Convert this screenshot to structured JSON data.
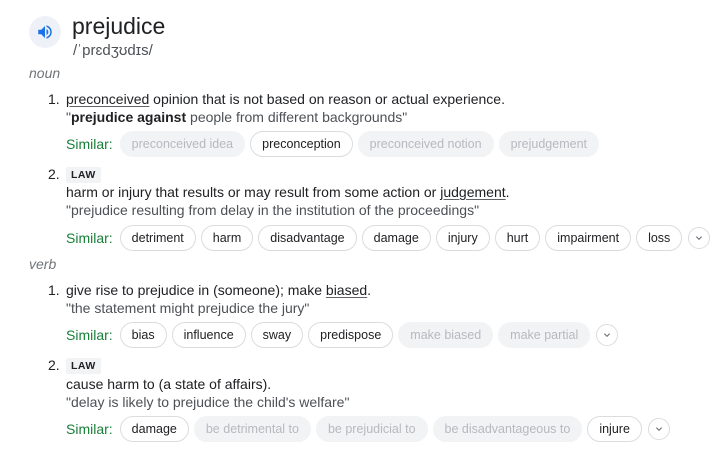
{
  "entry": {
    "word": "prejudice",
    "phonetic": "/ˈprɛdʒʊdɪs/",
    "audio_icon": "speaker-icon"
  },
  "noun": {
    "label": "noun",
    "senses": [
      {
        "number": "1.",
        "def_link": "preconceived",
        "def_rest": " opinion that is not based on reason or actual experience.",
        "example_open": "\"",
        "example_bold": "prejudice against",
        "example_rest": " people from different backgrounds\"",
        "similar_label": "Similar:",
        "similar": [
          {
            "text": "preconceived idea",
            "muted": true
          },
          {
            "text": "preconception",
            "muted": false
          },
          {
            "text": "preconceived notion",
            "muted": true
          },
          {
            "text": "prejudgement",
            "muted": true
          }
        ]
      },
      {
        "number": "2.",
        "tag": "LAW",
        "def_pre": "harm or injury that results or may result from some action or ",
        "def_link": "judgement",
        "def_post": ".",
        "example": "\"prejudice resulting from delay in the institution of the proceedings\"",
        "similar_label": "Similar:",
        "similar": [
          {
            "text": "detriment",
            "muted": false
          },
          {
            "text": "harm",
            "muted": false
          },
          {
            "text": "disadvantage",
            "muted": false
          },
          {
            "text": "damage",
            "muted": false
          },
          {
            "text": "injury",
            "muted": false
          },
          {
            "text": "hurt",
            "muted": false
          },
          {
            "text": "impairment",
            "muted": false
          },
          {
            "text": "loss",
            "muted": false
          }
        ]
      }
    ]
  },
  "verb": {
    "label": "verb",
    "senses": [
      {
        "number": "1.",
        "def_pre": "give rise to prejudice in (someone); make ",
        "def_link": "biased",
        "def_post": ".",
        "example": "\"the statement might prejudice the jury\"",
        "similar_label": "Similar:",
        "similar": [
          {
            "text": "bias",
            "muted": false
          },
          {
            "text": "influence",
            "muted": false
          },
          {
            "text": "sway",
            "muted": false
          },
          {
            "text": "predispose",
            "muted": false
          },
          {
            "text": "make biased",
            "muted": true
          },
          {
            "text": "make partial",
            "muted": true
          }
        ]
      },
      {
        "number": "2.",
        "tag": "LAW",
        "def": "cause harm to (a state of affairs).",
        "example": "\"delay is likely to prejudice the child's welfare\"",
        "similar_label": "Similar:",
        "similar": [
          {
            "text": "damage",
            "muted": false
          },
          {
            "text": "be detrimental to",
            "muted": true
          },
          {
            "text": "be prejudicial to",
            "muted": true
          },
          {
            "text": "be disadvantageous to",
            "muted": true
          },
          {
            "text": "injure",
            "muted": false
          }
        ]
      }
    ]
  },
  "expand_icon": "chevron-down-icon"
}
